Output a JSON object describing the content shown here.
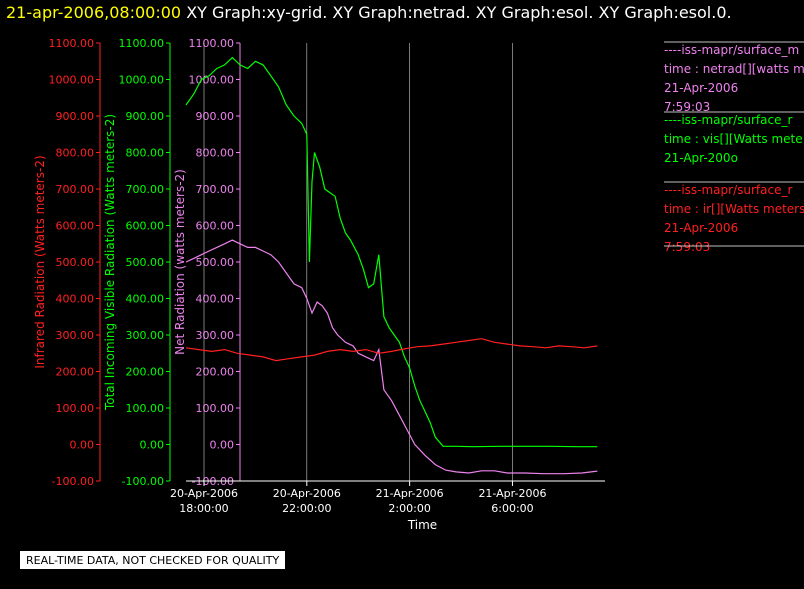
{
  "header": {
    "timestamp": "21-apr-2006,08:00:00",
    "graphs": "XY Graph:xy-grid.  XY Graph:netrad.  XY Graph:esol.  XY Graph:esol.0."
  },
  "footer_note": "REAL-TIME DATA, NOT CHECKED FOR QUALITY",
  "colors": {
    "ir": "#ff2020",
    "vis": "#00ff00",
    "net": "#ee82ee",
    "grid": "#ffffff",
    "background": "#000000"
  },
  "chart_data": {
    "type": "line",
    "xlabel": "Time",
    "x_ticks": [
      {
        "line1": "20-Apr-2006",
        "line2": "18:00:00",
        "hour": 18
      },
      {
        "line1": "20-Apr-2006",
        "line2": "22:00:00",
        "hour": 22
      },
      {
        "line1": "21-Apr-2006",
        "line2": "2:00:00",
        "hour": 26
      },
      {
        "line1": "21-Apr-2006",
        "line2": "6:00:00",
        "hour": 30
      }
    ],
    "xlim_hours": [
      17.3,
      33.6
    ],
    "grid": "vertical",
    "axes": [
      {
        "id": "ir",
        "label": "Infrared Radiation (Watts meters-2)",
        "color": "#ff2020",
        "ylim": [
          -100,
          1100
        ],
        "ticks": [
          "1100.00",
          "1000.00",
          "900.00",
          "800.00",
          "700.00",
          "600.00",
          "500.00",
          "400.00",
          "300.00",
          "200.00",
          "100.00",
          "0.00",
          "-100.00"
        ]
      },
      {
        "id": "vis",
        "label": "Total Incoming Visible Radiation (Watts meters-2)",
        "color": "#00ff00",
        "ylim": [
          -100,
          1100
        ],
        "ticks": [
          "1100.00",
          "1000.00",
          "900.00",
          "800.00",
          "700.00",
          "600.00",
          "500.00",
          "400.00",
          "300.00",
          "200.00",
          "100.00",
          "0.00",
          "-100.00"
        ]
      },
      {
        "id": "net",
        "label": "Net Radiation (watts meters-2)",
        "color": "#ee82ee",
        "ylim": [
          -100,
          1100
        ],
        "ticks": [
          "1100.00",
          "1000.00",
          "900.00",
          "800.00",
          "700.00",
          "600.00",
          "500.00",
          "400.00",
          "300.00",
          "200.00",
          "100.00",
          "0.00",
          "-100.00"
        ]
      }
    ],
    "series": [
      {
        "id": "vis",
        "color": "#00ff00",
        "points": [
          [
            17.3,
            930
          ],
          [
            17.6,
            960
          ],
          [
            17.9,
            1000
          ],
          [
            18.2,
            1010
          ],
          [
            18.5,
            1030
          ],
          [
            18.8,
            1040
          ],
          [
            19.1,
            1060
          ],
          [
            19.4,
            1040
          ],
          [
            19.7,
            1030
          ],
          [
            20.0,
            1050
          ],
          [
            20.3,
            1040
          ],
          [
            20.6,
            1010
          ],
          [
            20.9,
            980
          ],
          [
            21.2,
            930
          ],
          [
            21.5,
            900
          ],
          [
            21.8,
            880
          ],
          [
            22.0,
            850
          ],
          [
            22.1,
            500
          ],
          [
            22.2,
            720
          ],
          [
            22.3,
            800
          ],
          [
            22.5,
            760
          ],
          [
            22.7,
            700
          ],
          [
            22.9,
            690
          ],
          [
            23.1,
            680
          ],
          [
            23.3,
            620
          ],
          [
            23.5,
            580
          ],
          [
            23.7,
            560
          ],
          [
            24.0,
            520
          ],
          [
            24.2,
            480
          ],
          [
            24.4,
            430
          ],
          [
            24.6,
            440
          ],
          [
            24.8,
            520
          ],
          [
            25.0,
            350
          ],
          [
            25.2,
            320
          ],
          [
            25.4,
            300
          ],
          [
            25.6,
            280
          ],
          [
            25.8,
            240
          ],
          [
            26.0,
            210
          ],
          [
            26.2,
            160
          ],
          [
            26.4,
            120
          ],
          [
            26.6,
            90
          ],
          [
            26.8,
            60
          ],
          [
            27.0,
            20
          ],
          [
            27.3,
            -5
          ],
          [
            27.8,
            -5
          ],
          [
            28.5,
            -6
          ],
          [
            29.5,
            -5
          ],
          [
            30.5,
            -5
          ],
          [
            31.5,
            -5
          ],
          [
            32.5,
            -6
          ],
          [
            33.3,
            -6
          ]
        ]
      },
      {
        "id": "net",
        "color": "#ee82ee",
        "points": [
          [
            17.3,
            500
          ],
          [
            17.6,
            510
          ],
          [
            17.9,
            520
          ],
          [
            18.2,
            530
          ],
          [
            18.5,
            540
          ],
          [
            18.8,
            550
          ],
          [
            19.1,
            560
          ],
          [
            19.4,
            550
          ],
          [
            19.7,
            540
          ],
          [
            20.0,
            540
          ],
          [
            20.3,
            530
          ],
          [
            20.6,
            520
          ],
          [
            20.9,
            500
          ],
          [
            21.2,
            470
          ],
          [
            21.5,
            440
          ],
          [
            21.8,
            430
          ],
          [
            22.0,
            400
          ],
          [
            22.2,
            360
          ],
          [
            22.4,
            390
          ],
          [
            22.6,
            380
          ],
          [
            22.8,
            360
          ],
          [
            23.0,
            320
          ],
          [
            23.2,
            300
          ],
          [
            23.5,
            280
          ],
          [
            23.8,
            270
          ],
          [
            24.0,
            250
          ],
          [
            24.3,
            240
          ],
          [
            24.6,
            230
          ],
          [
            24.8,
            260
          ],
          [
            25.0,
            150
          ],
          [
            25.3,
            120
          ],
          [
            25.6,
            80
          ],
          [
            25.9,
            40
          ],
          [
            26.2,
            0
          ],
          [
            26.6,
            -30
          ],
          [
            27.0,
            -55
          ],
          [
            27.4,
            -70
          ],
          [
            27.8,
            -75
          ],
          [
            28.3,
            -78
          ],
          [
            28.8,
            -72
          ],
          [
            29.3,
            -72
          ],
          [
            29.8,
            -78
          ],
          [
            30.5,
            -78
          ],
          [
            31.2,
            -80
          ],
          [
            32.0,
            -80
          ],
          [
            32.7,
            -78
          ],
          [
            33.3,
            -73
          ]
        ]
      },
      {
        "id": "ir",
        "color": "#ff2020",
        "points": [
          [
            17.3,
            265
          ],
          [
            17.8,
            260
          ],
          [
            18.3,
            255
          ],
          [
            18.8,
            260
          ],
          [
            19.3,
            250
          ],
          [
            19.8,
            245
          ],
          [
            20.3,
            240
          ],
          [
            20.8,
            230
          ],
          [
            21.3,
            235
          ],
          [
            21.8,
            240
          ],
          [
            22.3,
            245
          ],
          [
            22.8,
            255
          ],
          [
            23.3,
            260
          ],
          [
            23.8,
            255
          ],
          [
            24.3,
            260
          ],
          [
            24.8,
            250
          ],
          [
            25.3,
            255
          ],
          [
            25.8,
            262
          ],
          [
            26.3,
            268
          ],
          [
            26.8,
            270
          ],
          [
            27.3,
            275
          ],
          [
            27.8,
            280
          ],
          [
            28.3,
            285
          ],
          [
            28.8,
            290
          ],
          [
            29.3,
            280
          ],
          [
            29.8,
            275
          ],
          [
            30.3,
            270
          ],
          [
            30.8,
            268
          ],
          [
            31.3,
            265
          ],
          [
            31.8,
            270
          ],
          [
            32.3,
            268
          ],
          [
            32.8,
            265
          ],
          [
            33.3,
            270
          ]
        ]
      }
    ]
  },
  "legend": [
    {
      "color": "#ee82ee",
      "lines": [
        "----iss-mapr/surface_m",
        "time : netrad[][watts me",
        "21-Apr-2006",
        "7:59:03"
      ]
    },
    {
      "color": "#00ff00",
      "lines": [
        "----iss-mapr/surface_r",
        "time : vis[][Watts mete",
        "21-Apr-200o",
        ""
      ]
    },
    {
      "color": "#ff2020",
      "lines": [
        "----iss-mapr/surface_r",
        "time : ir[][Watts meters",
        "21-Apr-2006",
        "7:59:03"
      ]
    }
  ]
}
